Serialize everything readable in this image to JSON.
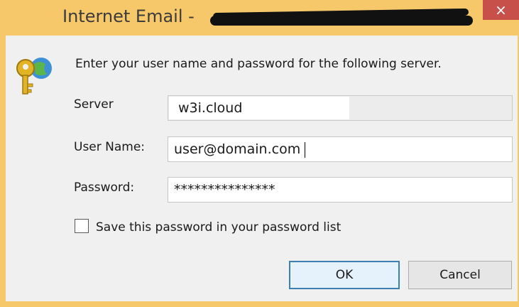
{
  "window": {
    "title": "Internet Email - ",
    "title_redacted": true,
    "close_label": "×"
  },
  "message": "Enter your user name and password for the following server.",
  "server": {
    "label": "Server",
    "value": "w3i.cloud"
  },
  "user_name": {
    "label": "User Name:",
    "value": "user@domain.com"
  },
  "password": {
    "label": "Password:",
    "value": "***************"
  },
  "save_password": {
    "label": "Save this password in your password list",
    "checked": false
  },
  "buttons": {
    "ok": "OK",
    "cancel": "Cancel"
  },
  "icons": {
    "dialog": "key-globe-icon"
  },
  "colors": {
    "title_bar": "#f7c86a",
    "close_button": "#c7504a",
    "body": "#f0f0f0"
  }
}
